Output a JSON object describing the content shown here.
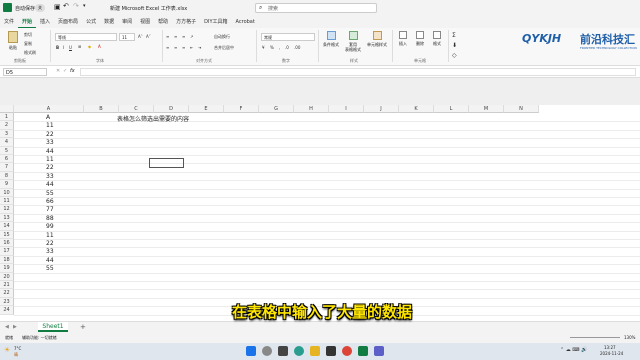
{
  "titlebar": {
    "autosave_label": "自动保存",
    "autosave_state": "关",
    "filename": "新建 Microsoft Excel 工作表.xlsx",
    "search_placeholder": "搜索"
  },
  "menu": [
    "文件",
    "开始",
    "插入",
    "页面布局",
    "公式",
    "数据",
    "审阅",
    "视图",
    "帮助",
    "方方格子",
    "DIY工具箱",
    "Acrobat"
  ],
  "menu_active_index": 1,
  "ribbon": {
    "paste": "粘贴",
    "cut": "剪切",
    "copy": "复制",
    "format_painter": "格式刷",
    "font_name": "等线",
    "font_size": "11",
    "wrap_text": "自动换行",
    "merge_center": "合并后居中",
    "number_format": "常规",
    "conditional_format": "条件格式",
    "table_format": "套用\n表格格式",
    "cell_style": "单元格样式",
    "insert": "插入",
    "delete": "删除",
    "format": "格式",
    "groups": [
      "剪贴板",
      "字体",
      "对齐方式",
      "数字",
      "样式",
      "单元格"
    ]
  },
  "logo": {
    "text": "QYKJH",
    "cn": "前沿科技汇",
    "sub": "FRONTIER TECHNOLOGY COLLECTION"
  },
  "formula_bar": {
    "name_box": "D5",
    "fx": "fx",
    "content": ""
  },
  "columns": [
    "A",
    "B",
    "C",
    "D",
    "E",
    "F",
    "G",
    "H",
    "I",
    "J",
    "K",
    "L",
    "M",
    "N"
  ],
  "rows": [
    {
      "n": "1",
      "a": "A"
    },
    {
      "n": "2",
      "a": "11"
    },
    {
      "n": "3",
      "a": "22"
    },
    {
      "n": "4",
      "a": "33"
    },
    {
      "n": "5",
      "a": "44"
    },
    {
      "n": "6",
      "a": "11"
    },
    {
      "n": "7",
      "a": "22"
    },
    {
      "n": "8",
      "a": "33"
    },
    {
      "n": "9",
      "a": "44"
    },
    {
      "n": "10",
      "a": "55"
    },
    {
      "n": "11",
      "a": "66"
    },
    {
      "n": "12",
      "a": "77"
    },
    {
      "n": "13",
      "a": "88"
    },
    {
      "n": "14",
      "a": "99"
    },
    {
      "n": "15",
      "a": "11"
    },
    {
      "n": "16",
      "a": "22"
    },
    {
      "n": "17",
      "a": "33"
    },
    {
      "n": "18",
      "a": "44"
    },
    {
      "n": "19",
      "a": "55"
    },
    {
      "n": "20",
      "a": ""
    },
    {
      "n": "21",
      "a": ""
    },
    {
      "n": "22",
      "a": ""
    },
    {
      "n": "23",
      "a": ""
    },
    {
      "n": "24",
      "a": ""
    }
  ],
  "c1_text": "表格怎么筛选出需要的内容",
  "sheet_tab": "Sheet1",
  "add_sheet": "+",
  "status": {
    "ready": "就绪",
    "accessibility": "辅助功能: 一切就绪",
    "zoom": "130%"
  },
  "taskbar": {
    "weather_temp": "7°C",
    "weather_text": "晴",
    "time": "13:27",
    "date": "2024-11-24"
  },
  "subtitle": "在表格中输入了大量的数据",
  "colors": {
    "excel_green": "#107c41",
    "subtitle_yellow": "#ffe600",
    "logo_blue": "#1f5fa8"
  }
}
